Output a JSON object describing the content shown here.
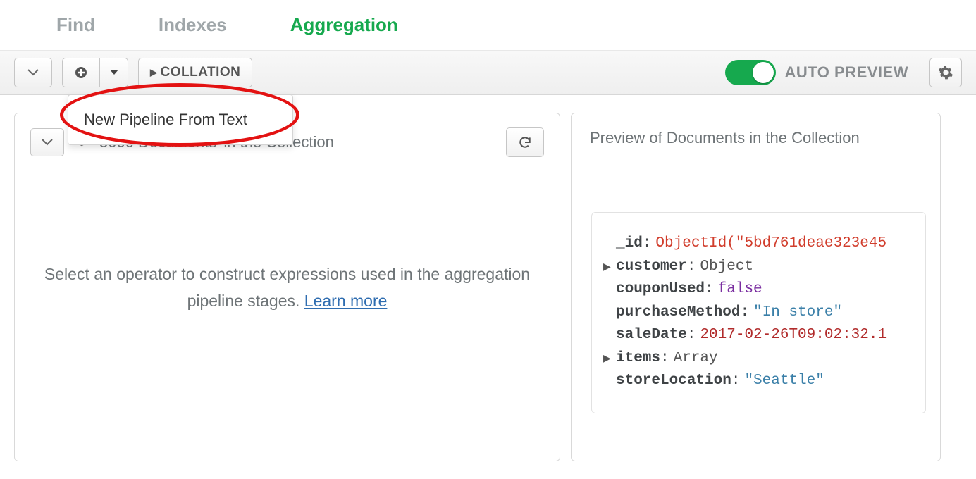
{
  "tabs": {
    "find": "Find",
    "indexes": "Indexes",
    "aggregation": "Aggregation"
  },
  "toolbar": {
    "collation_label": "COLLATION",
    "auto_preview_label": "AUTO PREVIEW"
  },
  "dropdown": {
    "new_pipeline_from_text": "New Pipeline From Text"
  },
  "left_panel": {
    "doc_count_strike": "5000 Documents",
    "doc_count_rest": "in the Collection",
    "placeholder_line": "Select an operator to construct expressions used in the aggregation pipeline stages.",
    "learn_more": "Learn more"
  },
  "right_panel": {
    "header": "Preview of Documents in the Collection",
    "doc": {
      "id_key": "_id",
      "id_val": "ObjectId(\"5bd761deae323e45",
      "customer_key": "customer",
      "customer_val": "Object",
      "coupon_key": "couponUsed",
      "coupon_val": "false",
      "purchase_key": "purchaseMethod",
      "purchase_val": "\"In store\"",
      "saledate_key": "saleDate",
      "saledate_val": "2017-02-26T09:02:32.1",
      "items_key": "items",
      "items_val": "Array",
      "store_key": "storeLocation",
      "store_val": "\"Seattle\""
    }
  }
}
